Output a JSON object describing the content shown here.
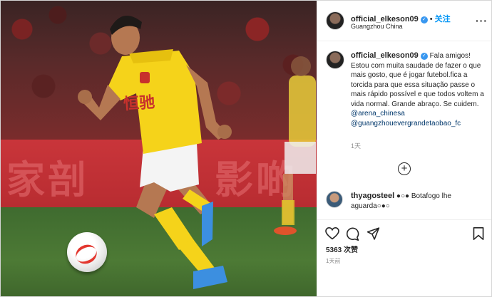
{
  "post": {
    "username": "official_elkeson09",
    "verified_mark": "✓",
    "follow_label": "关注",
    "separator": "•",
    "location": "Guangzhou China",
    "more_label": "···"
  },
  "photo": {
    "board_text_left": "家剖",
    "board_text_right": "影啲",
    "shirt_text": "恒驰"
  },
  "caption": {
    "username": "official_elkeson09",
    "verified_mark": "✓",
    "text": "Fala amigos! Estou com muita saudade de fazer o que mais gosto, que é jogar futebol.fica a torcida para que essa situação passe o mais rápido possível e que todos voltem a vida normal. Grande abraço. Se cuidem.",
    "mentions": [
      "@arena_chinesa",
      "@guangzhouevergrandetaobao_fc"
    ],
    "time": "1天"
  },
  "load_more": {
    "label": "+"
  },
  "comment": {
    "username": "thyagosteel",
    "text": "●○● Botafogo lhe aguarda○●○"
  },
  "actions": {
    "likes": "5363 次赞",
    "time": "1天前"
  },
  "colors": {
    "link": "#0095f6",
    "mention": "#00376b",
    "verified": "#3897f0",
    "jersey": "#f5d31a"
  }
}
